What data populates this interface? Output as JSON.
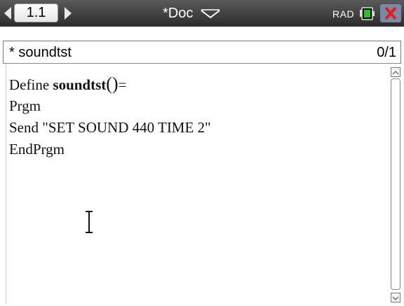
{
  "toolbar": {
    "page_tab": "1.1",
    "doc_title": "*Doc",
    "mode": "RAD"
  },
  "program_bar": {
    "name": "* soundtst",
    "count": "0/1"
  },
  "editor": {
    "line1_prefix": "Define ",
    "line1_name": "soundtst",
    "line1_paren": "()",
    "line1_suffix": "=",
    "line2": "Prgm",
    "line3": "Send \"SET SOUND 440 TIME 2\"",
    "line4": "EndPrgm"
  },
  "icons": {
    "prev_page": "chevron-left-icon",
    "next_page": "chevron-right-icon",
    "doc_menu": "chevron-down-icon",
    "battery": "battery-icon",
    "close": "close-icon",
    "cursor": "ibeam-cursor-icon"
  },
  "colors": {
    "toolbar_dark": "#2c2c2c",
    "close_red": "#e02020",
    "battery_green": "#2fbf2f"
  }
}
